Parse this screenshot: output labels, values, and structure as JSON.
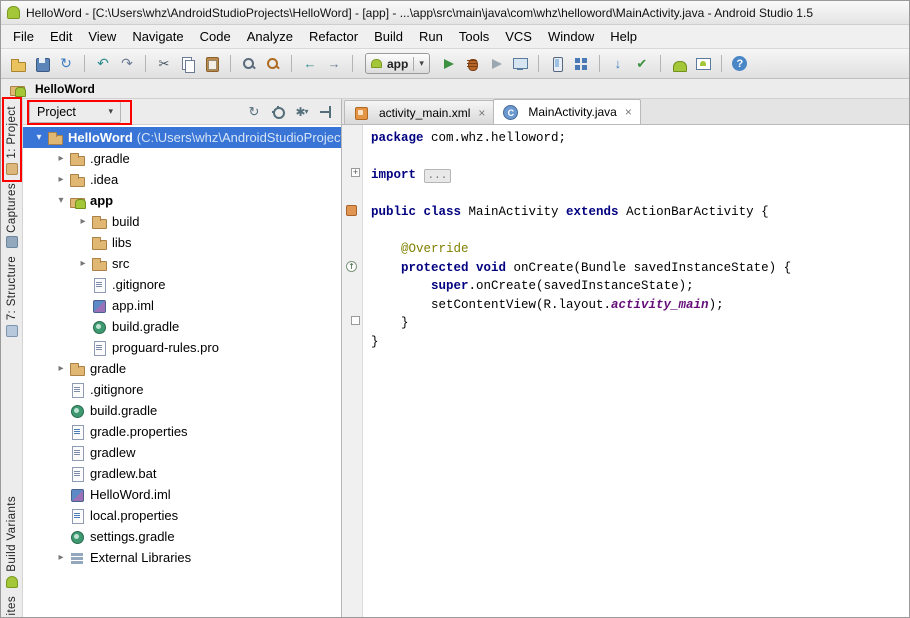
{
  "window": {
    "title": "HelloWord - [C:\\Users\\whz\\AndroidStudioProjects\\HelloWord] - [app] - ...\\app\\src\\main\\java\\com\\whz\\helloword\\MainActivity.java - Android Studio 1.5"
  },
  "menu": {
    "items": [
      "File",
      "Edit",
      "View",
      "Navigate",
      "Code",
      "Analyze",
      "Refactor",
      "Build",
      "Run",
      "Tools",
      "VCS",
      "Window",
      "Help"
    ]
  },
  "toolbar": {
    "run_config_label": "app",
    "icons": [
      "open",
      "save",
      "sync",
      "|",
      "undo",
      "redo",
      "|",
      "cut",
      "copy",
      "paste",
      "|",
      "find",
      "replace",
      "|",
      "back",
      "forward",
      "|",
      "run-config",
      "run",
      "debug",
      "coverage",
      "attach-debugger",
      "|",
      "avd-manager",
      "sdk-manager",
      "|",
      "vcs-update",
      "vcs-commit",
      "|",
      "gradle-sync",
      "device-monitor",
      "|",
      "help"
    ]
  },
  "activity_bar": {
    "top": [
      {
        "id": "project",
        "label": "1: Project",
        "icon": "project-tool"
      },
      {
        "id": "captures",
        "label": "Captures",
        "icon": "captures-tool"
      },
      {
        "id": "structure",
        "label": "7: Structure",
        "icon": "structure-tool"
      }
    ],
    "bottom": [
      {
        "id": "build-variants",
        "label": "Build Variants",
        "icon": "android-tool"
      },
      {
        "id": "favorites",
        "label": "ites",
        "icon": null
      }
    ]
  },
  "breadcrumb": {
    "project": "HelloWord"
  },
  "project_panel": {
    "mode_label": "Project",
    "toolbar_icons": [
      "refresh",
      "locate",
      "settings",
      "hide"
    ],
    "tree": [
      {
        "level": 0,
        "arrow": "expanded",
        "icon": "folder",
        "label": "HelloWord",
        "suffix": " (C:\\Users\\whz\\AndroidStudioProjects\\HelloWord)",
        "selected": true,
        "bold": true
      },
      {
        "level": 1,
        "arrow": "collapsed",
        "icon": "folder",
        "label": ".gradle"
      },
      {
        "level": 1,
        "arrow": "collapsed",
        "icon": "folder",
        "label": ".idea"
      },
      {
        "level": 1,
        "arrow": "expanded",
        "icon": "android-module",
        "label": "app",
        "bold": true
      },
      {
        "level": 2,
        "arrow": "collapsed",
        "icon": "folder",
        "label": "build"
      },
      {
        "level": 2,
        "arrow": null,
        "icon": "folder",
        "label": "libs"
      },
      {
        "level": 2,
        "arrow": "collapsed",
        "icon": "folder",
        "label": "src"
      },
      {
        "level": 2,
        "arrow": null,
        "icon": "text-file",
        "label": ".gitignore"
      },
      {
        "level": 2,
        "arrow": null,
        "icon": "iml-file",
        "label": "app.iml"
      },
      {
        "level": 2,
        "arrow": null,
        "icon": "gradle-file",
        "label": "build.gradle"
      },
      {
        "level": 2,
        "arrow": null,
        "icon": "text-file",
        "label": "proguard-rules.pro"
      },
      {
        "level": 1,
        "arrow": "collapsed",
        "icon": "folder",
        "label": "gradle"
      },
      {
        "level": 1,
        "arrow": null,
        "icon": "text-file",
        "label": ".gitignore"
      },
      {
        "level": 1,
        "arrow": null,
        "icon": "gradle-file",
        "label": "build.gradle"
      },
      {
        "level": 1,
        "arrow": null,
        "icon": "properties-file",
        "label": "gradle.properties"
      },
      {
        "level": 1,
        "arrow": null,
        "icon": "text-file",
        "label": "gradlew"
      },
      {
        "level": 1,
        "arrow": null,
        "icon": "text-file",
        "label": "gradlew.bat"
      },
      {
        "level": 1,
        "arrow": null,
        "icon": "iml-file",
        "label": "HelloWord.iml"
      },
      {
        "level": 1,
        "arrow": null,
        "icon": "properties-file",
        "label": "local.properties"
      },
      {
        "level": 1,
        "arrow": null,
        "icon": "gradle-file",
        "label": "settings.gradle"
      },
      {
        "level": 1,
        "arrow": "collapsed",
        "icon": "libraries",
        "label": "External Libraries"
      }
    ]
  },
  "editor": {
    "tabs": [
      {
        "icon": "layout-xml",
        "label": "activity_main.xml",
        "close": "×",
        "active": false
      },
      {
        "icon": "java-class",
        "label": "MainActivity.java",
        "close": "×",
        "active": true
      }
    ],
    "gutter_icons": [
      {
        "line": 3,
        "type": "fold-plus"
      },
      {
        "line": 5,
        "type": "marker"
      },
      {
        "line": 8,
        "type": "override"
      },
      {
        "line": 11,
        "type": "fold-end"
      }
    ],
    "code": [
      [
        [
          "kw",
          "package"
        ],
        [
          "pl",
          " com.whz.helloword;"
        ]
      ],
      [],
      [
        [
          "kw",
          "import"
        ],
        [
          "pl",
          " "
        ],
        [
          "fold",
          "..."
        ]
      ],
      [],
      [
        [
          "kw",
          "public class"
        ],
        [
          "pl",
          " MainActivity "
        ],
        [
          "kw",
          "extends"
        ],
        [
          "pl",
          " ActionBarActivity {"
        ]
      ],
      [],
      [
        [
          "pl",
          "    "
        ],
        [
          "ann",
          "@Override"
        ]
      ],
      [
        [
          "pl",
          "    "
        ],
        [
          "kw",
          "protected void"
        ],
        [
          "pl",
          " onCreate(Bundle savedInstanceState) {"
        ]
      ],
      [
        [
          "pl",
          "        "
        ],
        [
          "kw",
          "super"
        ],
        [
          "pl",
          ".onCreate(savedInstanceState);"
        ]
      ],
      [
        [
          "pl",
          "        setContentView(R.layout."
        ],
        [
          "field",
          "activity_main"
        ],
        [
          "pl",
          ");"
        ]
      ],
      [
        [
          "pl",
          "    }"
        ]
      ],
      [
        [
          "pl",
          "}"
        ]
      ]
    ]
  },
  "colors": {
    "selection": "#3875d6",
    "keyword": "#000080",
    "annotation": "#808000",
    "field_ref": "#660e7a",
    "annotation_box": "#ff0000"
  }
}
